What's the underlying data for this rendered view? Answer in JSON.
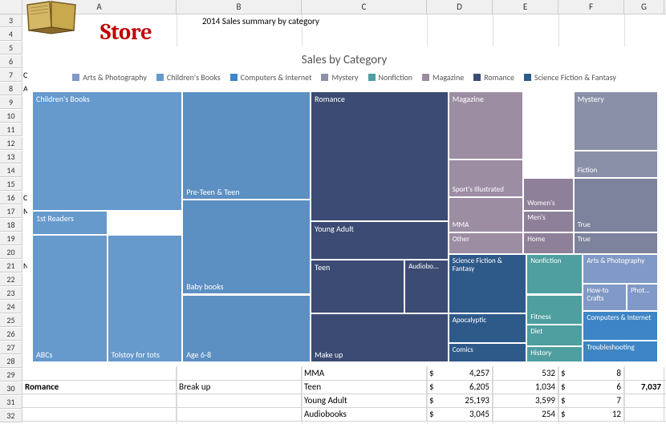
{
  "columns": [
    "A",
    "B",
    "C",
    "D",
    "E",
    "F",
    "G"
  ],
  "row_numbers": [
    3,
    4,
    5,
    6,
    7,
    8,
    9,
    10,
    11,
    12,
    13,
    14,
    15,
    16,
    17,
    18,
    19,
    20,
    21,
    22,
    23,
    24,
    25,
    26,
    27,
    28,
    29,
    30,
    31,
    32
  ],
  "row_labels_left": {
    "7": "C",
    "8": "A",
    "16": "C",
    "17": "M",
    "21": "N"
  },
  "store_label": "Store",
  "subtitle": "2014 Sales summary by category",
  "chart_title": "Sales by Category",
  "legend": [
    {
      "label": "Arts & Photography",
      "color": "#8199c6"
    },
    {
      "label": "Children's Books",
      "color": "#6699cc"
    },
    {
      "label": "Computers & Internet",
      "color": "#3d85c6"
    },
    {
      "label": "Mystery",
      "color": "#8a90a8"
    },
    {
      "label": "Nonfiction",
      "color": "#4f9ea0"
    },
    {
      "label": "Magazine",
      "color": "#9c8da3"
    },
    {
      "label": "Romance",
      "color": "#3b4b73"
    },
    {
      "label": "Science Fiction & Fantasy",
      "color": "#2e5a8a"
    }
  ],
  "chart_data": {
    "type": "treemap",
    "title": "Sales by Category",
    "series": [
      {
        "category": "Children's Books",
        "label": "Children's Books",
        "value": 90,
        "color": "#6699cc"
      },
      {
        "category": "Children's Books",
        "label": "1st Readers",
        "value": 16,
        "color": "#6699cc"
      },
      {
        "category": "Children's Books",
        "label": "ABCs",
        "value": 26,
        "color": "#6699cc"
      },
      {
        "category": "Children's Books",
        "label": "Tolstoy for tots",
        "value": 22,
        "color": "#6699cc"
      },
      {
        "category": "Children's Books",
        "label": "Pre-Teen & Teen",
        "value": 42,
        "color": "#5c8fc2"
      },
      {
        "category": "Children's Books",
        "label": "Baby books",
        "value": 42,
        "color": "#5c8fc2"
      },
      {
        "category": "Children's Books",
        "label": "Age 6-8",
        "value": 42,
        "color": "#5c8fc2"
      },
      {
        "category": "Romance",
        "label": "Romance",
        "value": 70,
        "color": "#3b4b73"
      },
      {
        "category": "Romance",
        "label": "Young Adult",
        "value": 30,
        "color": "#3b4b73"
      },
      {
        "category": "Romance",
        "label": "Teen",
        "value": 18,
        "color": "#3b4b73"
      },
      {
        "category": "Romance",
        "label": "Audiobo...",
        "value": 10,
        "color": "#3b4b73"
      },
      {
        "category": "Romance",
        "label": "Make up",
        "value": 22,
        "color": "#3b4b73"
      },
      {
        "category": "Magazine",
        "label": "Magazine",
        "value": 28,
        "color": "#9c8da3"
      },
      {
        "category": "Magazine",
        "label": "Sport's Illustrated",
        "value": 18,
        "color": "#9c8da3"
      },
      {
        "category": "Magazine",
        "label": "MMA",
        "value": 10,
        "color": "#9c8da3"
      },
      {
        "category": "Magazine",
        "label": "Other",
        "value": 8,
        "color": "#9c8da3"
      },
      {
        "category": "Magazine",
        "label": "Women's",
        "value": 10,
        "color": "#8f8099"
      },
      {
        "category": "Magazine",
        "label": "Men's",
        "value": 8,
        "color": "#8f8099"
      },
      {
        "category": "Magazine",
        "label": "Home",
        "value": 6,
        "color": "#8f8099"
      },
      {
        "category": "Mystery",
        "label": "Mystery",
        "value": 22,
        "color": "#8a90a8"
      },
      {
        "category": "Mystery",
        "label": "Fiction",
        "value": 10,
        "color": "#8a90a8"
      },
      {
        "category": "Mystery",
        "label": "True",
        "value": 14,
        "color": "#7d839c"
      },
      {
        "category": "Mystery",
        "label": "True",
        "value": 8,
        "color": "#7d839c"
      },
      {
        "category": "Science Fiction & Fantasy",
        "label": "Science Fiction & Fantasy",
        "value": 20,
        "color": "#2e5a8a"
      },
      {
        "category": "Science Fiction & Fantasy",
        "label": "Apocalyptic",
        "value": 12,
        "color": "#2e5a8a"
      },
      {
        "category": "Science Fiction & Fantasy",
        "label": "Comics",
        "value": 8,
        "color": "#2e5a8a"
      },
      {
        "category": "Nonfiction",
        "label": "Nonfiction",
        "value": 10,
        "color": "#4f9ea0"
      },
      {
        "category": "Nonfiction",
        "label": "Fitness",
        "value": 8,
        "color": "#4f9ea0"
      },
      {
        "category": "Nonfiction",
        "label": "Diet",
        "value": 6,
        "color": "#4f9ea0"
      },
      {
        "category": "Nonfiction",
        "label": "History",
        "value": 4,
        "color": "#4f9ea0"
      },
      {
        "category": "Arts & Photography",
        "label": "Arts & Photography",
        "value": 6,
        "color": "#8199c6"
      },
      {
        "category": "Arts & Photography",
        "label": "How-to Crafts",
        "value": 4,
        "color": "#8199c6"
      },
      {
        "category": "Arts & Photography",
        "label": "Phot...",
        "value": 3,
        "color": "#8199c6"
      },
      {
        "category": "Computers & Internet",
        "label": "Computers & Internet",
        "value": 6,
        "color": "#3d85c6"
      },
      {
        "category": "Computers & Internet",
        "label": "Troubleshooting",
        "value": 4,
        "color": "#3d85c6"
      }
    ]
  },
  "table": {
    "rows": [
      {
        "a": "",
        "b": "",
        "c": "MMA",
        "d": "4,257",
        "e": "532",
        "f": "8",
        "g": ""
      },
      {
        "a": "Romance",
        "b": "Break up",
        "c": "Teen",
        "d": "6,205",
        "e": "1,034",
        "f": "6",
        "g": "7,037"
      },
      {
        "a": "",
        "b": "",
        "c": "Young Adult",
        "d": "25,193",
        "e": "3,599",
        "f": "7",
        "g": ""
      },
      {
        "a": "",
        "b": "",
        "c": "Audiobooks",
        "d": "3,045",
        "e": "254",
        "f": "12",
        "g": ""
      }
    ],
    "currency": "$",
    "g_header": "Romance"
  }
}
